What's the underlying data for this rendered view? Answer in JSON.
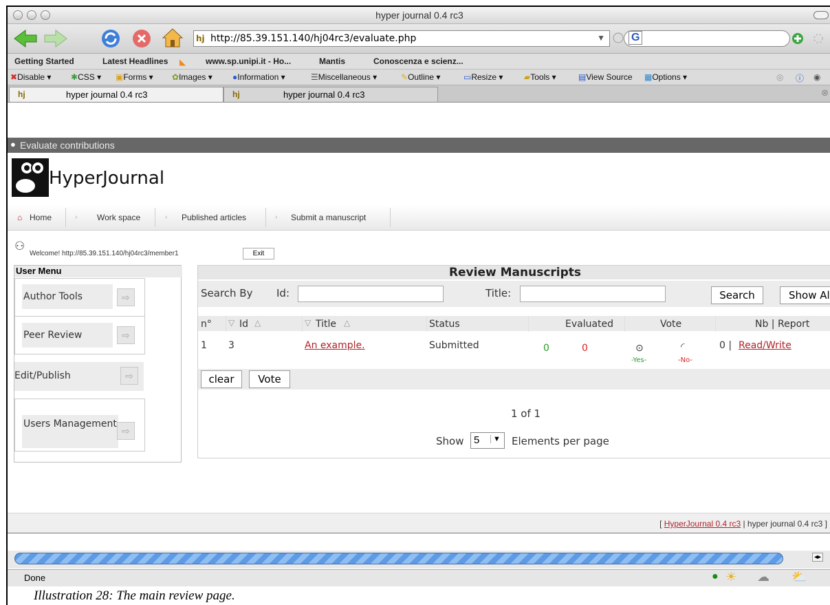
{
  "browser": {
    "window_title": "hyper journal 0.4 rc3",
    "url": "http://85.39.151.140/hj04rc3/evaluate.php",
    "search_engine_glyph": "G",
    "bookmarks": [
      "Getting Started",
      "Latest Headlines",
      "www.sp.unipi.it - Ho...",
      "Mantis",
      "Conoscenza e scienz..."
    ],
    "webdev_items": [
      "Disable",
      "CSS",
      "Forms",
      "Images",
      "Information",
      "Miscellaneous",
      "Outline",
      "Resize",
      "Tools",
      "View Source",
      "Options"
    ],
    "tabs": [
      "hyper journal 0.4 rc3",
      "hyper journal 0.4 rc3"
    ],
    "status_text": "Done"
  },
  "page": {
    "header": "Evaluate contributions",
    "logo_text": "HyperJournal",
    "nav": [
      "Home",
      "Work space",
      "Published articles",
      "Submit a manuscript"
    ],
    "welcome": "Welcome! http://85.39.151.140/hj04rc3/member1",
    "exit_label": "Exit"
  },
  "user_menu": {
    "title": "User Menu",
    "items": [
      "Author Tools",
      "Peer Review",
      "Edit/Publish",
      "Users Management"
    ]
  },
  "review": {
    "title": "Review Manuscripts",
    "search_by": "Search By",
    "id_label": "Id:",
    "title_label": "Title:",
    "search_btn": "Search",
    "showall_btn": "Show Al",
    "columns": {
      "n": "n°",
      "id": "Id",
      "title": "Title",
      "status": "Status",
      "evaluated": "Evaluated",
      "vote": "Vote",
      "nb_report": "Nb | Report"
    },
    "rows": [
      {
        "n": "1",
        "id": "3",
        "title": "An example.",
        "status": "Submitted",
        "eval_yes": "0",
        "eval_no": "0",
        "vote_yes": "-Yes-",
        "vote_no": "-No-",
        "nb": "0 |",
        "report": "Read/Write"
      }
    ],
    "clear_btn": "clear",
    "vote_btn": "Vote",
    "pagination": "1 of 1",
    "show_label": "Show",
    "per_page_value": "5",
    "per_page_suffix": "Elements per page"
  },
  "footer": {
    "open": "[",
    "link": "HyperJournal 0.4 rc3",
    "rest": "| hyper journal 0.4 rc3 ]"
  },
  "caption": "Illustration 28: The main review page."
}
